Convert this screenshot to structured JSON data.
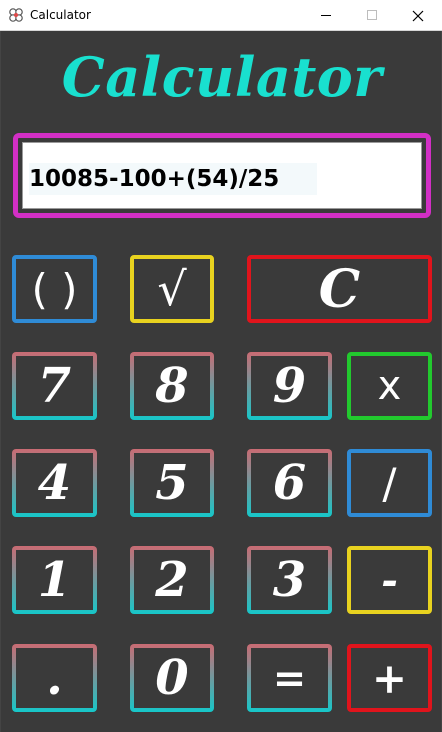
{
  "window": {
    "title": "Calculator",
    "icon": "calculator-app-icon",
    "controls": [
      "minimize-icon",
      "maximize-icon",
      "close-icon"
    ]
  },
  "header": {
    "title": "Calculator"
  },
  "display": {
    "value": "10085-100+(54)/25"
  },
  "keys": {
    "parens": "( )",
    "sqrt": "√",
    "clear": "C",
    "seven": "7",
    "eight": "8",
    "nine": "9",
    "multiply": "x",
    "four": "4",
    "five": "5",
    "six": "6",
    "divide": "/",
    "one": "1",
    "two": "2",
    "three": "3",
    "subtract": "-",
    "dot": ".",
    "zero": "0",
    "equals": "=",
    "add": "+"
  },
  "colors": {
    "background": "#3a3a3a",
    "title": "#19e0cf",
    "display_border": "#d22fc5",
    "parens_border": "#2f8bd6",
    "sqrt_border": "#e8d21f",
    "clear_border": "#e0141c",
    "multiply_border": "#22c92e",
    "divide_border": "#2f8bd6",
    "subtract_border": "#e8d21f",
    "add_border": "#e0141c",
    "digit_border_top": "#c96b73",
    "digit_border_bottom": "#16c7c9"
  }
}
